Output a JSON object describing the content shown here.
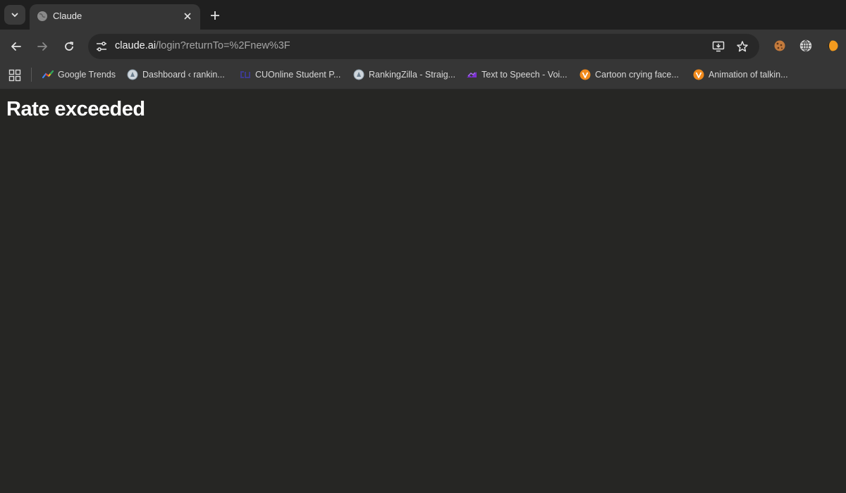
{
  "tab": {
    "title": "Claude"
  },
  "address_bar": {
    "host": "claude.ai",
    "path": "/login?returnTo=%2Fnew%3F"
  },
  "bookmarks": [
    {
      "label": "Google Trends",
      "icon": "google-trends-icon"
    },
    {
      "label": "Dashboard ‹ rankin...",
      "icon": "globe-icon"
    },
    {
      "label": "CUOnline Student P...",
      "icon": "cu-logo-icon"
    },
    {
      "label": "RankingZilla - Straig...",
      "icon": "globe-icon"
    },
    {
      "label": "Text to Speech - Voi...",
      "icon": "tts-icon"
    },
    {
      "label": "Cartoon crying face...",
      "icon": "vecteezy-icon"
    },
    {
      "label": "Animation of talkin...",
      "icon": "vecteezy-icon"
    }
  ],
  "page": {
    "heading": "Rate exceeded"
  },
  "colors": {
    "background": "#262624",
    "chrome": "#363636",
    "tabstrip": "#1f1f1f"
  }
}
